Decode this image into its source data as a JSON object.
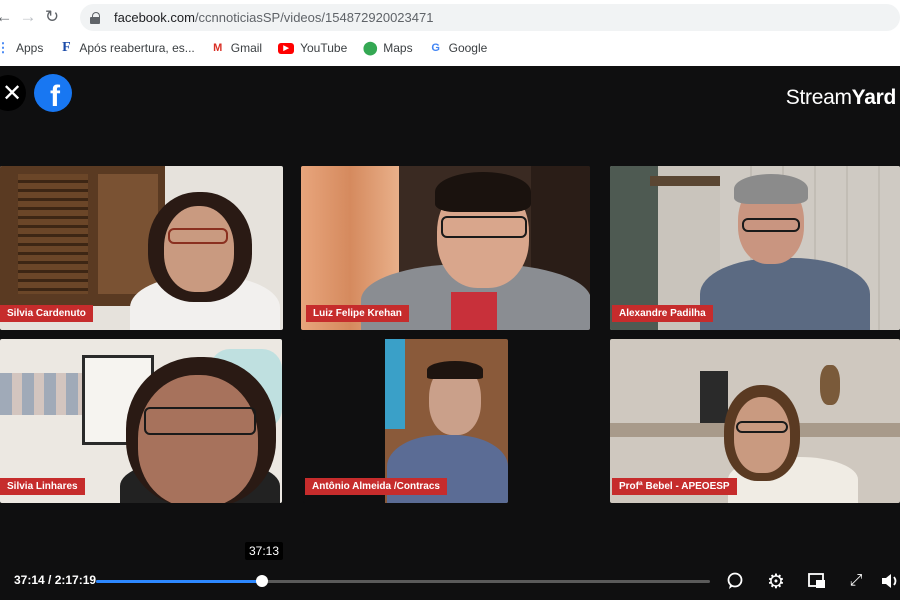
{
  "browser": {
    "url_host": "facebook.com",
    "url_path": "/ccnnoticiasSP/videos/154872920023471",
    "bookmarks": [
      {
        "label": "Apps",
        "icon": "apps-grid-icon"
      },
      {
        "label": "Após reabertura, es...",
        "icon": "f-site-icon"
      },
      {
        "label": "Gmail",
        "icon": "gmail-icon"
      },
      {
        "label": "YouTube",
        "icon": "youtube-icon"
      },
      {
        "label": "Maps",
        "icon": "maps-pin-icon"
      },
      {
        "label": "Google",
        "icon": "google-icon"
      }
    ]
  },
  "player": {
    "brand_stream": "Stream",
    "brand_yard": "Yard",
    "participants": [
      {
        "name": "Silvia Cardenuto"
      },
      {
        "name": "Luiz Felipe Krehan"
      },
      {
        "name": "Alexandre Padilha"
      },
      {
        "name": "Silvia Linhares"
      },
      {
        "name": "Antônio Almeida /Contracs"
      },
      {
        "name": "Profª Bebel - APEOESP"
      }
    ],
    "tooltip_time": "37:13",
    "current_time": "37:14",
    "duration": "2:17:19",
    "time_display": "37:14 / 2:17:19",
    "progress_fraction": 0.2706,
    "accent_color": "#2d88ff",
    "name_tag_color": "#c62c2c"
  }
}
